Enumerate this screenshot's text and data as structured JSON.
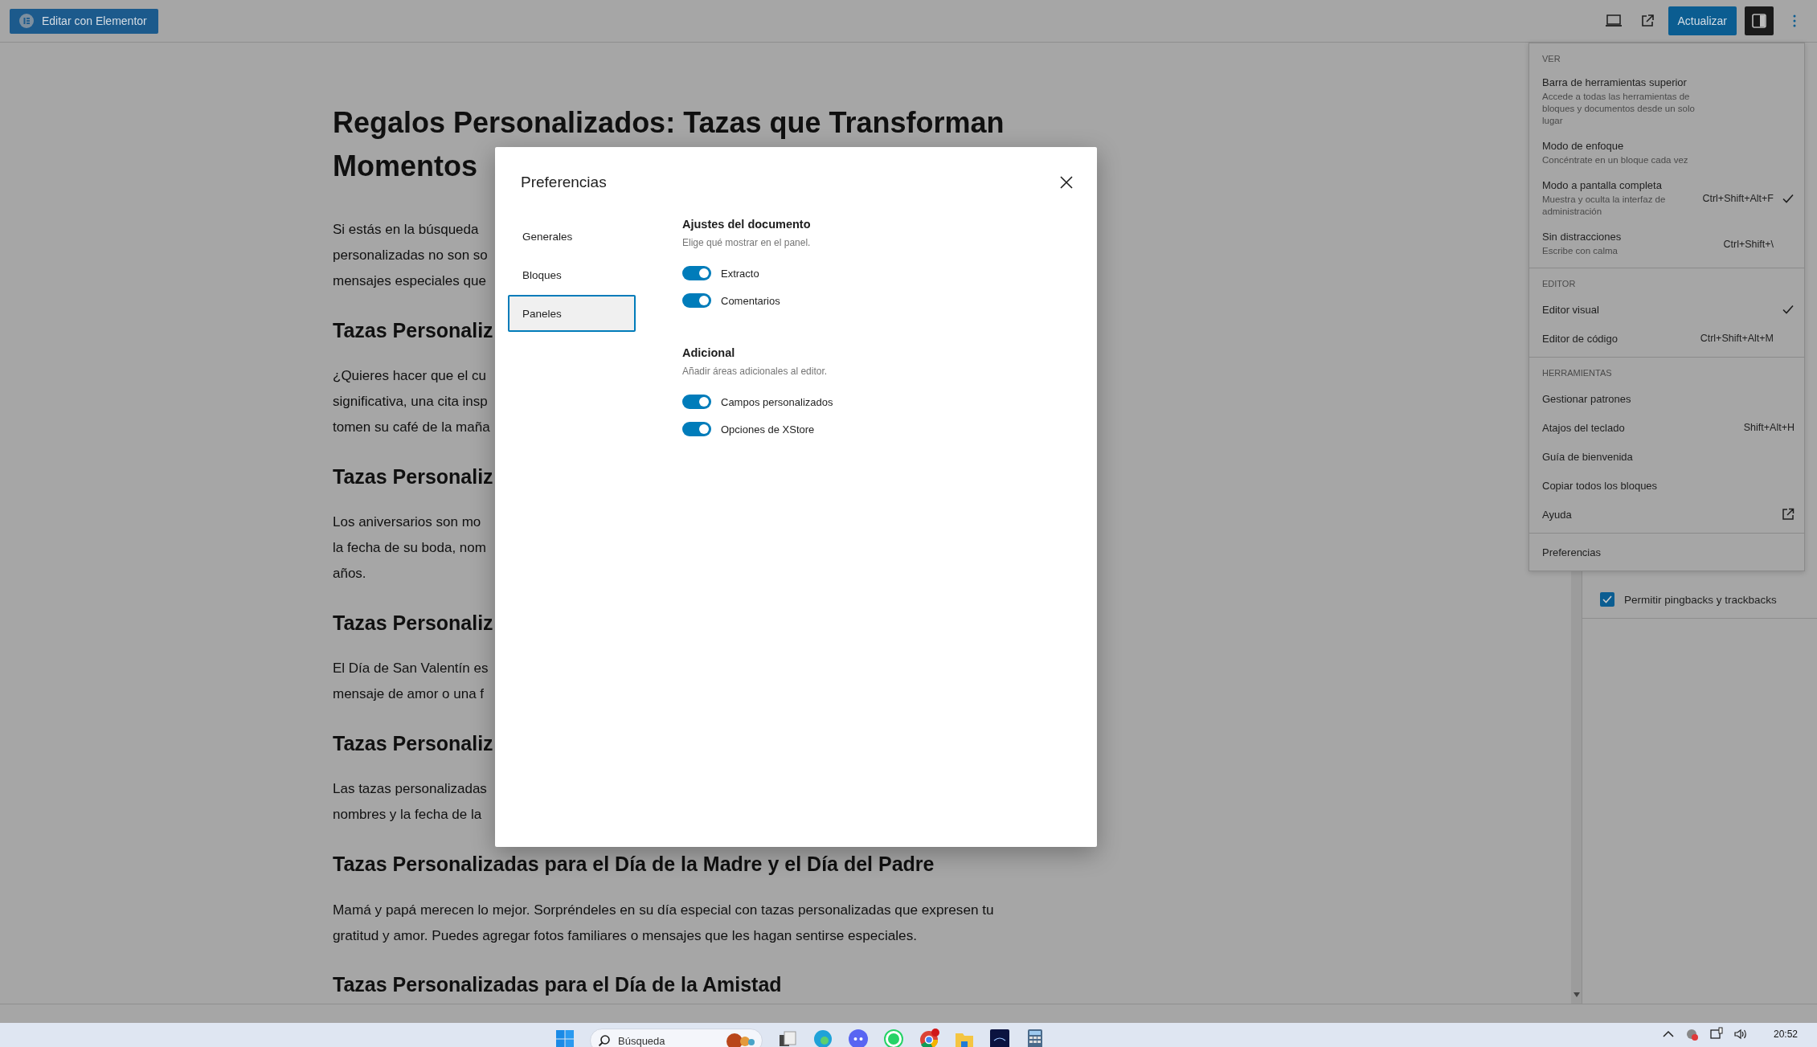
{
  "top_bar": {
    "elementor_button": "Editar con Elementor",
    "update_button": "Actualizar",
    "settings_toggle": {
      "on": true
    }
  },
  "article": {
    "title_lines": [
      "Regalos Personalizados: Tazas que Transforman",
      "Momentos"
    ],
    "blocks": [
      {
        "kind": "paragraph",
        "lines": [
          "Si estás en la búsqueda",
          "personalizadas no son so",
          "mensajes especiales que"
        ]
      },
      {
        "kind": "heading",
        "text": "Tazas Personaliz"
      },
      {
        "kind": "paragraph",
        "lines": [
          "¿Quieres hacer que el cu",
          "significativa, una cita insp",
          "tomen su café de la maña"
        ]
      },
      {
        "kind": "heading",
        "text": "Tazas Personaliz"
      },
      {
        "kind": "paragraph",
        "lines": [
          "Los aniversarios son mo",
          "la fecha de su boda, nom",
          "años."
        ]
      },
      {
        "kind": "heading",
        "text": "Tazas Personaliz"
      },
      {
        "kind": "paragraph",
        "lines": [
          "El Día de San Valentín es",
          "mensaje de amor o una f"
        ]
      },
      {
        "kind": "heading",
        "text": "Tazas Personaliz"
      },
      {
        "kind": "paragraph",
        "lines": [
          "Las tazas personalizadas",
          "nombres y la fecha de la"
        ]
      },
      {
        "kind": "heading",
        "text": "Tazas Personalizadas para el Día de la Madre y el Día del Padre"
      },
      {
        "kind": "full_paragraph",
        "text": "Mamá y papá merecen lo mejor. Sorpréndeles en su día especial con tazas personalizadas que expresen tu gratitud y amor. Puedes agregar fotos familiares o mensajes que les hagan sentirse especiales."
      },
      {
        "kind": "heading",
        "text": "Tazas Personalizadas para el Día de la Amistad"
      }
    ]
  },
  "sidebar": {
    "checkbox": {
      "label": "Permitir pingbacks y trackbacks",
      "checked": true
    }
  },
  "modal": {
    "title": "Preferencias",
    "nav": [
      {
        "label": "Generales",
        "selected": false
      },
      {
        "label": "Bloques",
        "selected": false
      },
      {
        "label": "Paneles",
        "selected": true
      }
    ],
    "sections": [
      {
        "title": "Ajustes del documento",
        "description": "Elige qué mostrar en el panel.",
        "toggles": [
          {
            "label": "Extracto",
            "on": true
          },
          {
            "label": "Comentarios",
            "on": true
          }
        ]
      },
      {
        "title": "Adicional",
        "description": "Añadir áreas adicionales al editor.",
        "toggles": [
          {
            "label": "Campos personalizados",
            "on": true
          },
          {
            "label": "Opciones de XStore",
            "on": true
          }
        ]
      }
    ]
  },
  "menu": {
    "sections": [
      {
        "heading": "VER",
        "items": [
          {
            "label": "Barra de herramientas superior",
            "description": "Accede a todas las herramientas de bloques y documentos desde un solo lugar",
            "checked": false
          },
          {
            "label": "Modo de enfoque",
            "description": "Concéntrate en un bloque cada vez",
            "checked": false
          },
          {
            "label": "Modo a pantalla completa",
            "description": "Muestra y oculta la interfaz de administración",
            "shortcut": "Ctrl+Shift+Alt+F",
            "checked": true
          },
          {
            "label": "Sin distracciones",
            "description": "Escribe con calma",
            "shortcut": "Ctrl+Shift+\\",
            "checked": false
          }
        ]
      },
      {
        "heading": "EDITOR",
        "items": [
          {
            "label": "Editor visual",
            "checked": true
          },
          {
            "label": "Editor de código",
            "shortcut": "Ctrl+Shift+Alt+M",
            "checked": false
          }
        ]
      },
      {
        "heading": "HERRAMIENTAS",
        "items": [
          {
            "label": "Gestionar patrones",
            "kind": "action"
          },
          {
            "label": "Atajos del teclado",
            "shortcut": "Shift+Alt+H",
            "kind": "action"
          },
          {
            "label": "Guía de bienvenida",
            "kind": "action"
          },
          {
            "label": "Copiar todos los bloques",
            "kind": "action"
          },
          {
            "label": "Ayuda",
            "kind": "external"
          }
        ]
      },
      {
        "items": [
          {
            "label": "Preferencias",
            "kind": "action"
          }
        ]
      }
    ]
  },
  "taskbar": {
    "search": {
      "placeholder": "Búsqueda"
    },
    "clock": "20:52"
  }
}
